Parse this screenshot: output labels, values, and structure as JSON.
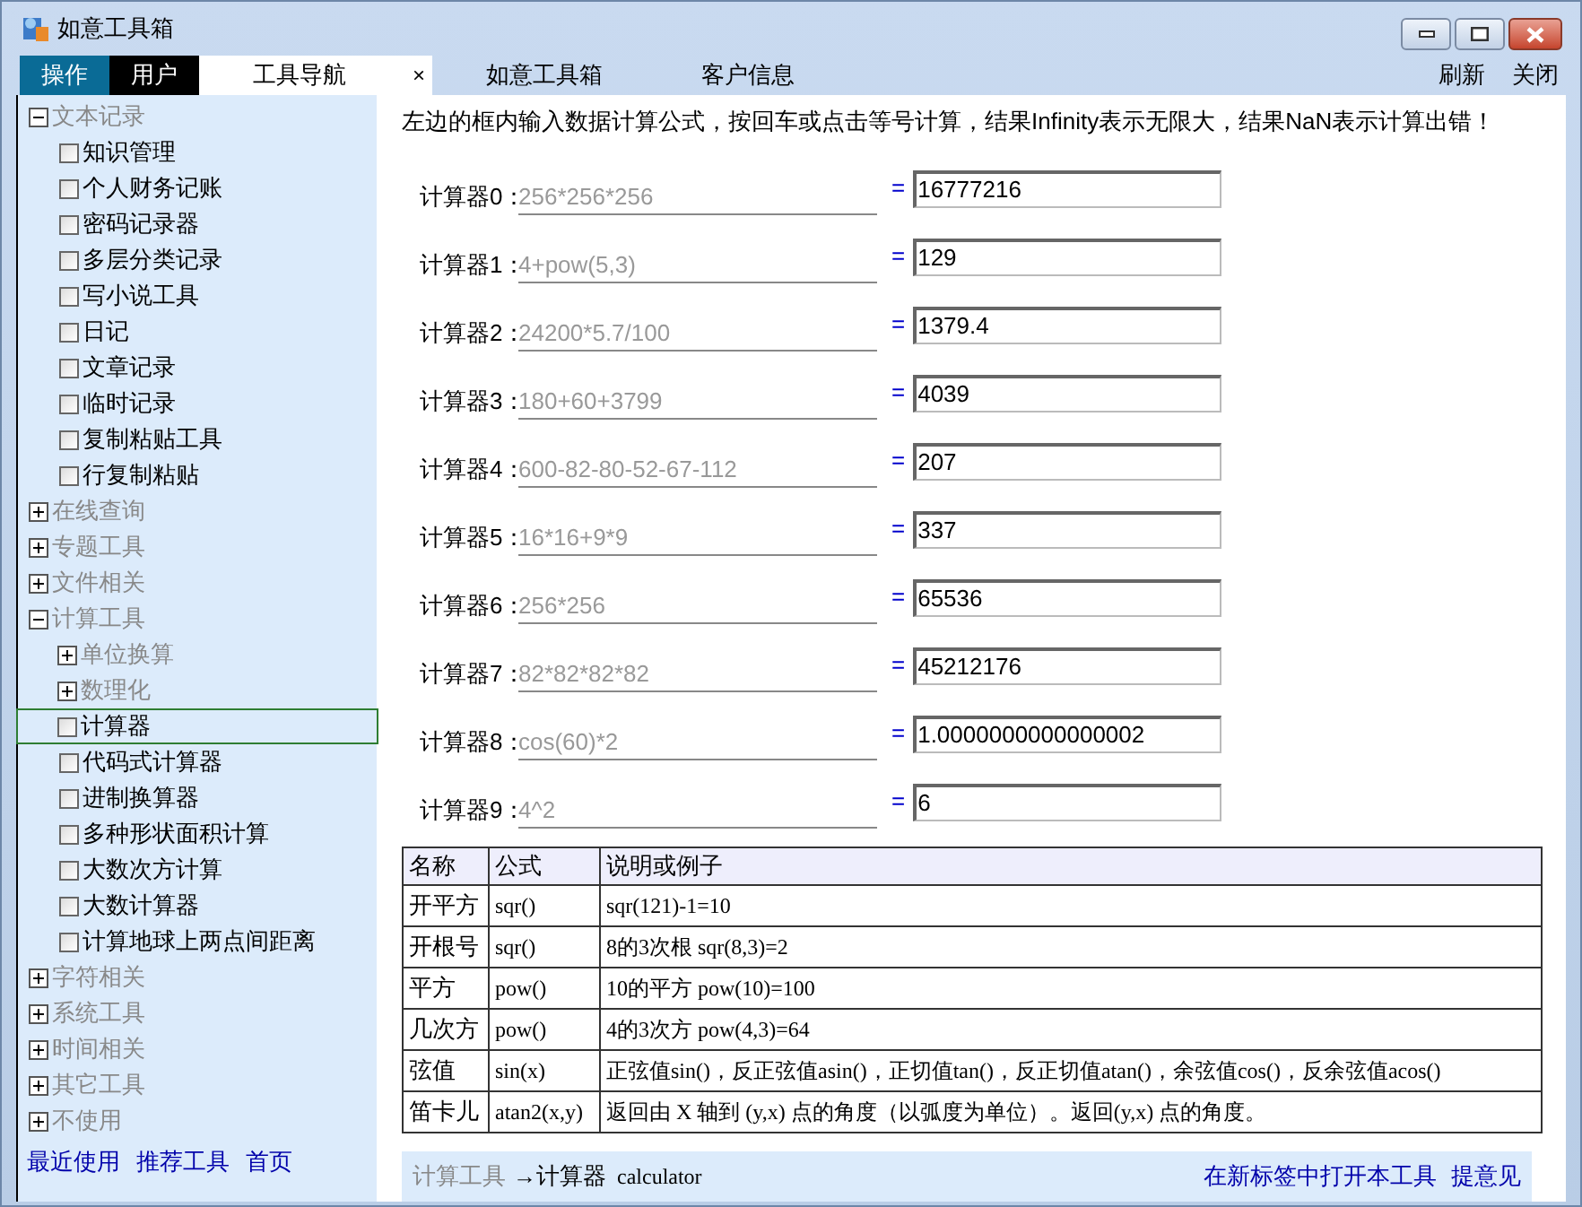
{
  "window": {
    "title": "如意工具箱"
  },
  "menu": [
    {
      "label": "操作",
      "kind": "accent"
    },
    {
      "label": "用户",
      "kind": "dark"
    }
  ],
  "tabs": [
    {
      "label": "工具导航",
      "selected": true,
      "close": "×"
    },
    {
      "label": "如意工具箱",
      "selected": false
    },
    {
      "label": "客户信息",
      "selected": false
    }
  ],
  "actions": [
    "刷新",
    "关闭"
  ],
  "sidebar": {
    "tree": [
      {
        "label": "文本记录",
        "kind": "group",
        "expanded": true,
        "children": [
          {
            "label": "知识管理",
            "kind": "leaf",
            "selected": false
          },
          {
            "label": "个人财务记账",
            "kind": "leaf",
            "selected": false
          },
          {
            "label": "密码记录器",
            "kind": "leaf",
            "selected": false
          },
          {
            "label": "多层分类记录",
            "kind": "leaf",
            "selected": false
          },
          {
            "label": "写小说工具",
            "kind": "leaf",
            "selected": false
          },
          {
            "label": "日记",
            "kind": "leaf",
            "selected": false
          },
          {
            "label": "文章记录",
            "kind": "leaf",
            "selected": false
          },
          {
            "label": "临时记录",
            "kind": "leaf",
            "selected": false
          },
          {
            "label": "复制粘贴工具",
            "kind": "leaf",
            "selected": false
          },
          {
            "label": "行复制粘贴",
            "kind": "leaf",
            "selected": false
          }
        ]
      },
      {
        "label": "在线查询",
        "kind": "group",
        "expanded": false
      },
      {
        "label": "专题工具",
        "kind": "group",
        "expanded": false
      },
      {
        "label": "文件相关",
        "kind": "group",
        "expanded": false
      },
      {
        "label": "计算工具",
        "kind": "group",
        "expanded": true,
        "children": [
          {
            "label": "单位换算",
            "kind": "group",
            "expanded": false
          },
          {
            "label": "数理化",
            "kind": "group",
            "expanded": false
          },
          {
            "label": "计算器",
            "kind": "leaf",
            "selected": true
          },
          {
            "label": "代码式计算器",
            "kind": "leaf",
            "selected": false
          },
          {
            "label": "进制换算器",
            "kind": "leaf",
            "selected": false
          },
          {
            "label": "多种形状面积计算",
            "kind": "leaf",
            "selected": false
          },
          {
            "label": "大数次方计算",
            "kind": "leaf",
            "selected": false
          },
          {
            "label": "大数计算器",
            "kind": "leaf",
            "selected": false
          },
          {
            "label": "计算地球上两点间距离",
            "kind": "leaf",
            "selected": false
          }
        ]
      },
      {
        "label": "字符相关",
        "kind": "group",
        "expanded": false
      },
      {
        "label": "系统工具",
        "kind": "group",
        "expanded": false
      },
      {
        "label": "时间相关",
        "kind": "group",
        "expanded": false
      },
      {
        "label": "其它工具",
        "kind": "group",
        "expanded": false
      },
      {
        "label": "不使用",
        "kind": "group",
        "expanded": false
      }
    ],
    "links": [
      "最近使用",
      "推荐工具",
      "首页"
    ]
  },
  "instruction": "左边的框内输入数据计算公式，按回车或点击等号计算，结果Infinity表示无限大，结果NaN表示计算出错！",
  "calculators": [
    {
      "label": "计算器0：",
      "placeholder": "256*256*256",
      "equals": "=",
      "result": "16777216"
    },
    {
      "label": "计算器1：",
      "placeholder": "4+pow(5,3)",
      "equals": "=",
      "result": "129"
    },
    {
      "label": "计算器2：",
      "placeholder": "24200*5.7/100",
      "equals": "=",
      "result": "1379.4"
    },
    {
      "label": "计算器3：",
      "placeholder": "180+60+3799",
      "equals": "=",
      "result": "4039"
    },
    {
      "label": "计算器4：",
      "placeholder": "600-82-80-52-67-112",
      "equals": "=",
      "result": "207"
    },
    {
      "label": "计算器5：",
      "placeholder": "16*16+9*9",
      "equals": "=",
      "result": "337"
    },
    {
      "label": "计算器6：",
      "placeholder": "256*256",
      "equals": "=",
      "result": "65536"
    },
    {
      "label": "计算器7：",
      "placeholder": "82*82*82*82",
      "equals": "=",
      "result": "45212176"
    },
    {
      "label": "计算器8：",
      "placeholder": "cos(60)*2",
      "equals": "=",
      "result": "1.0000000000000002"
    },
    {
      "label": "计算器9：",
      "placeholder": "4^2",
      "equals": "=",
      "result": "6"
    }
  ],
  "table": {
    "columns": [
      "名称",
      "公式",
      "说明或例子"
    ],
    "rows": [
      [
        "开平方",
        "sqr()",
        "sqr(121)-1=10"
      ],
      [
        "开根号",
        "sqr()",
        "8的3次根  sqr(8,3)=2"
      ],
      [
        "平方",
        "pow()",
        "10的平方  pow(10)=100"
      ],
      [
        "几次方",
        "pow()",
        "4的3次方  pow(4,3)=64"
      ],
      [
        "弦值",
        "sin(x)",
        "正弦值sin()，反正弦值asin()，正切值tan()，反正切值atan()，余弦值cos()，反余弦值acos()"
      ],
      [
        "笛卡儿",
        "atan2(x,y)",
        "返回由  X 轴到  (y,x) 点的角度（以弧度为单位）。返回(y,x) 点的角度。"
      ]
    ]
  },
  "footer": {
    "breadcrumb_parent": "计算工具",
    "breadcrumb_current": "→计算器",
    "tool_id": "calculator",
    "links": [
      "在新标签中打开本工具",
      "提意见"
    ]
  }
}
